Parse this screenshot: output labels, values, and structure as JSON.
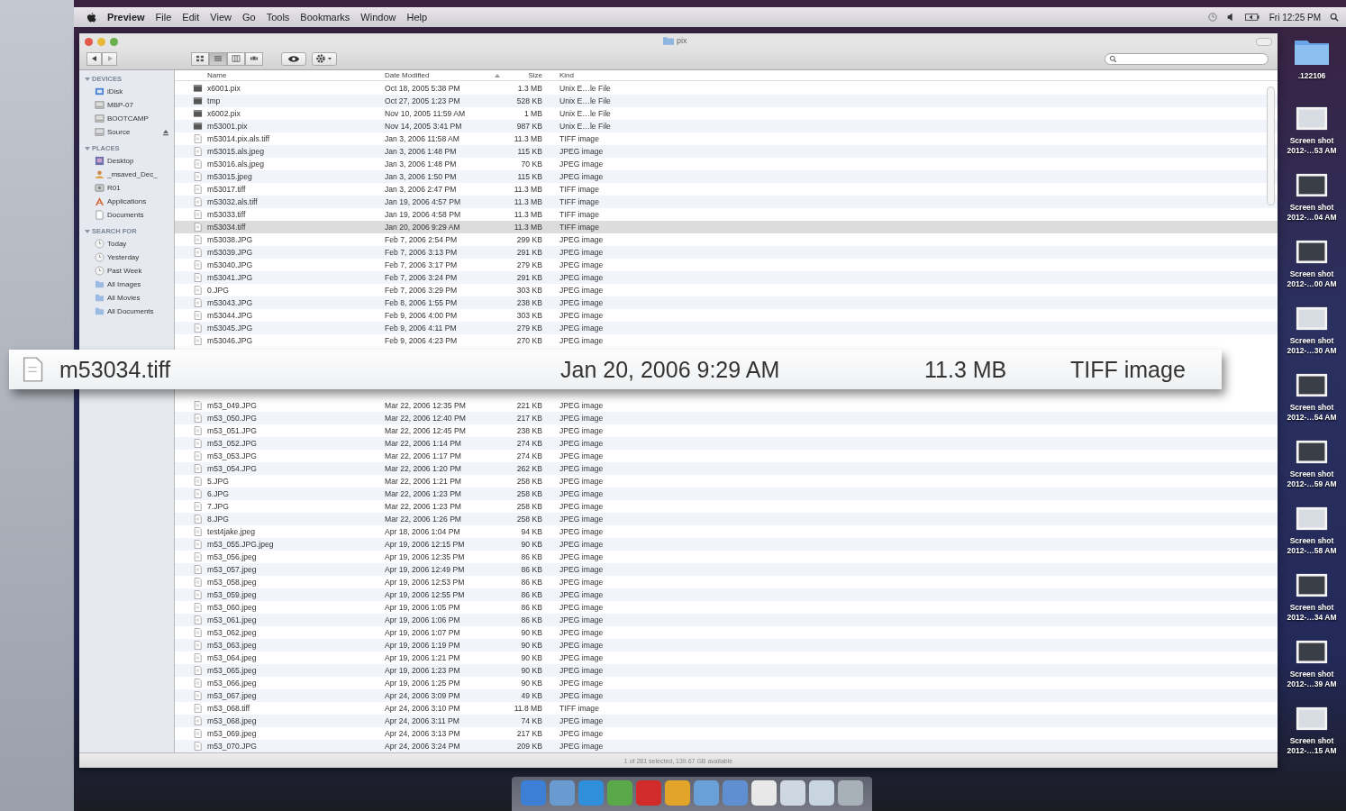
{
  "menubar": {
    "app": "Preview",
    "items": [
      "File",
      "Edit",
      "View",
      "Go",
      "Tools",
      "Bookmarks",
      "Window",
      "Help"
    ],
    "clock": "Fri 12:25 PM"
  },
  "window": {
    "title": "pix"
  },
  "toolbar": {
    "views": [
      {
        "kind": "icon",
        "selected": false
      },
      {
        "kind": "list",
        "selected": true
      },
      {
        "kind": "column",
        "selected": false
      },
      {
        "kind": "coverflow",
        "selected": false
      }
    ]
  },
  "sidebar": {
    "sections": [
      {
        "title": "DEVICES",
        "items": [
          {
            "label": "iDisk",
            "kind": "idisk",
            "eject": false
          },
          {
            "label": "MBP-07",
            "kind": "drive",
            "eject": false
          },
          {
            "label": "BOOTCAMP",
            "kind": "drive",
            "eject": false
          },
          {
            "label": "Source",
            "kind": "drive",
            "eject": true
          }
        ]
      },
      {
        "title": "PLACES",
        "items": [
          {
            "label": "Desktop",
            "kind": "desktop",
            "eject": false
          },
          {
            "label": "_msaved_Dec_",
            "kind": "user",
            "eject": false
          },
          {
            "label": "R01",
            "kind": "network",
            "eject": false
          },
          {
            "label": "Applications",
            "kind": "apps",
            "eject": false
          },
          {
            "label": "Documents",
            "kind": "docs",
            "eject": false
          }
        ]
      },
      {
        "title": "SEARCH FOR",
        "items": [
          {
            "label": "Today",
            "kind": "clock",
            "eject": false
          },
          {
            "label": "Yesterday",
            "kind": "clock",
            "eject": false
          },
          {
            "label": "Past Week",
            "kind": "clock",
            "eject": false
          },
          {
            "label": "All Images",
            "kind": "folder",
            "eject": false
          },
          {
            "label": "All Movies",
            "kind": "folder",
            "eject": false
          },
          {
            "label": "All Documents",
            "kind": "folder",
            "eject": false
          }
        ]
      }
    ]
  },
  "table": {
    "columns": [
      "Name",
      "Date Modified",
      "Size",
      "Kind"
    ],
    "rows": [
      {
        "kind": "exec",
        "name": "x6001.pix",
        "date": "Oct 18, 2005 5:38 PM",
        "size": "1.3 MB",
        "type": "Unix E…le File",
        "selected": false
      },
      {
        "kind": "exec",
        "name": "tmp",
        "date": "Oct 27, 2005 1:23 PM",
        "size": "528 KB",
        "type": "Unix E…le File",
        "selected": false
      },
      {
        "kind": "exec",
        "name": "x6002.pix",
        "date": "Nov 10, 2005 11:59 AM",
        "size": "1 MB",
        "type": "Unix E…le File",
        "selected": false
      },
      {
        "kind": "exec",
        "name": "m53001.pix",
        "date": "Nov 14, 2005 3:41 PM",
        "size": "987 KB",
        "type": "Unix E…le File",
        "selected": false
      },
      {
        "kind": "doc",
        "name": "m53014.pix.als.tiff",
        "date": "Jan 3, 2006 11:58 AM",
        "size": "11.3 MB",
        "type": "TIFF image",
        "selected": false
      },
      {
        "kind": "doc",
        "name": "m53015.als.jpeg",
        "date": "Jan 3, 2006 1:48 PM",
        "size": "115 KB",
        "type": "JPEG image",
        "selected": false
      },
      {
        "kind": "doc",
        "name": "m53016.als.jpeg",
        "date": "Jan 3, 2006 1:48 PM",
        "size": "70 KB",
        "type": "JPEG image",
        "selected": false
      },
      {
        "kind": "doc",
        "name": "m53015.jpeg",
        "date": "Jan 3, 2006 1:50 PM",
        "size": "115 KB",
        "type": "JPEG image",
        "selected": false
      },
      {
        "kind": "doc",
        "name": "m53017.tiff",
        "date": "Jan 3, 2006 2:47 PM",
        "size": "11.3 MB",
        "type": "TIFF image",
        "selected": false
      },
      {
        "kind": "doc",
        "name": "m53032.als.tiff",
        "date": "Jan 19, 2006 4:57 PM",
        "size": "11.3 MB",
        "type": "TIFF image",
        "selected": false
      },
      {
        "kind": "doc",
        "name": "m53033.tiff",
        "date": "Jan 19, 2006 4:58 PM",
        "size": "11.3 MB",
        "type": "TIFF image",
        "selected": false
      },
      {
        "kind": "doc",
        "name": "m53034.tiff",
        "date": "Jan 20, 2006 9:29 AM",
        "size": "11.3 MB",
        "type": "TIFF image",
        "selected": true
      },
      {
        "kind": "doc",
        "name": "m53038.JPG",
        "date": "Feb 7, 2006 2:54 PM",
        "size": "299 KB",
        "type": "JPEG image",
        "selected": false
      },
      {
        "kind": "doc",
        "name": "m53039.JPG",
        "date": "Feb 7, 2006 3:13 PM",
        "size": "291 KB",
        "type": "JPEG image",
        "selected": false
      },
      {
        "kind": "doc",
        "name": "m53040.JPG",
        "date": "Feb 7, 2006 3:17 PM",
        "size": "279 KB",
        "type": "JPEG image",
        "selected": false
      },
      {
        "kind": "doc",
        "name": "m53041.JPG",
        "date": "Feb 7, 2006 3:24 PM",
        "size": "291 KB",
        "type": "JPEG image",
        "selected": false
      },
      {
        "kind": "doc",
        "name": "0.JPG",
        "date": "Feb 7, 2006 3:29 PM",
        "size": "303 KB",
        "type": "JPEG image",
        "selected": false
      },
      {
        "kind": "doc",
        "name": "m53043.JPG",
        "date": "Feb 8, 2006 1:55 PM",
        "size": "238 KB",
        "type": "JPEG image",
        "selected": false
      },
      {
        "kind": "doc",
        "name": "m53044.JPG",
        "date": "Feb 9, 2006 4:00 PM",
        "size": "303 KB",
        "type": "JPEG image",
        "selected": false
      },
      {
        "kind": "doc",
        "name": "m53045.JPG",
        "date": "Feb 9, 2006 4:11 PM",
        "size": "279 KB",
        "type": "JPEG image",
        "selected": false
      },
      {
        "kind": "doc",
        "name": "m53046.JPG",
        "date": "Feb 9, 2006 4:23 PM",
        "size": "270 KB",
        "type": "JPEG image",
        "selected": false
      }
    ],
    "rows_after_callout": [
      {
        "kind": "doc",
        "name": "m53_049.JPG",
        "date": "Mar 22, 2006 12:35 PM",
        "size": "221 KB",
        "type": "JPEG image",
        "selected": false
      },
      {
        "kind": "doc",
        "name": "m53_050.JPG",
        "date": "Mar 22, 2006 12:40 PM",
        "size": "217 KB",
        "type": "JPEG image",
        "selected": false
      },
      {
        "kind": "doc",
        "name": "m53_051.JPG",
        "date": "Mar 22, 2006 12:45 PM",
        "size": "238 KB",
        "type": "JPEG image",
        "selected": false
      },
      {
        "kind": "doc",
        "name": "m53_052.JPG",
        "date": "Mar 22, 2006 1:14 PM",
        "size": "274 KB",
        "type": "JPEG image",
        "selected": false
      },
      {
        "kind": "doc",
        "name": "m53_053.JPG",
        "date": "Mar 22, 2006 1:17 PM",
        "size": "274 KB",
        "type": "JPEG image",
        "selected": false
      },
      {
        "kind": "doc",
        "name": "m53_054.JPG",
        "date": "Mar 22, 2006 1:20 PM",
        "size": "262 KB",
        "type": "JPEG image",
        "selected": false
      },
      {
        "kind": "doc",
        "name": "5.JPG",
        "date": "Mar 22, 2006 1:21 PM",
        "size": "258 KB",
        "type": "JPEG image",
        "selected": false
      },
      {
        "kind": "doc",
        "name": "6.JPG",
        "date": "Mar 22, 2006 1:23 PM",
        "size": "258 KB",
        "type": "JPEG image",
        "selected": false
      },
      {
        "kind": "doc",
        "name": "7.JPG",
        "date": "Mar 22, 2006 1:23 PM",
        "size": "258 KB",
        "type": "JPEG image",
        "selected": false
      },
      {
        "kind": "doc",
        "name": "8.JPG",
        "date": "Mar 22, 2006 1:26 PM",
        "size": "258 KB",
        "type": "JPEG image",
        "selected": false
      },
      {
        "kind": "doc",
        "name": "test4jake.jpeg",
        "date": "Apr 18, 2006 1:04 PM",
        "size": "94 KB",
        "type": "JPEG image",
        "selected": false
      },
      {
        "kind": "doc",
        "name": "m53_055.JPG.jpeg",
        "date": "Apr 19, 2006 12:15 PM",
        "size": "90 KB",
        "type": "JPEG image",
        "selected": false
      },
      {
        "kind": "doc",
        "name": "m53_056.jpeg",
        "date": "Apr 19, 2006 12:35 PM",
        "size": "86 KB",
        "type": "JPEG image",
        "selected": false
      },
      {
        "kind": "doc",
        "name": "m53_057.jpeg",
        "date": "Apr 19, 2006 12:49 PM",
        "size": "86 KB",
        "type": "JPEG image",
        "selected": false
      },
      {
        "kind": "doc",
        "name": "m53_058.jpeg",
        "date": "Apr 19, 2006 12:53 PM",
        "size": "86 KB",
        "type": "JPEG image",
        "selected": false
      },
      {
        "kind": "doc",
        "name": "m53_059.jpeg",
        "date": "Apr 19, 2006 12:55 PM",
        "size": "86 KB",
        "type": "JPEG image",
        "selected": false
      },
      {
        "kind": "doc",
        "name": "m53_060.jpeg",
        "date": "Apr 19, 2006 1:05 PM",
        "size": "86 KB",
        "type": "JPEG image",
        "selected": false
      },
      {
        "kind": "doc",
        "name": "m53_061.jpeg",
        "date": "Apr 19, 2006 1:06 PM",
        "size": "86 KB",
        "type": "JPEG image",
        "selected": false
      },
      {
        "kind": "doc",
        "name": "m53_062.jpeg",
        "date": "Apr 19, 2006 1:07 PM",
        "size": "90 KB",
        "type": "JPEG image",
        "selected": false
      },
      {
        "kind": "doc",
        "name": "m53_063.jpeg",
        "date": "Apr 19, 2006 1:19 PM",
        "size": "90 KB",
        "type": "JPEG image",
        "selected": false
      },
      {
        "kind": "doc",
        "name": "m53_064.jpeg",
        "date": "Apr 19, 2006 1:21 PM",
        "size": "90 KB",
        "type": "JPEG image",
        "selected": false
      },
      {
        "kind": "doc",
        "name": "m53_065.jpeg",
        "date": "Apr 19, 2006 1:23 PM",
        "size": "90 KB",
        "type": "JPEG image",
        "selected": false
      },
      {
        "kind": "doc",
        "name": "m53_066.jpeg",
        "date": "Apr 19, 2006 1:25 PM",
        "size": "90 KB",
        "type": "JPEG image",
        "selected": false
      },
      {
        "kind": "doc",
        "name": "m53_067.jpeg",
        "date": "Apr 24, 2006 3:09 PM",
        "size": "49 KB",
        "type": "JPEG image",
        "selected": false
      },
      {
        "kind": "doc",
        "name": "m53_068.tiff",
        "date": "Apr 24, 2006 3:10 PM",
        "size": "11.8 MB",
        "type": "TIFF image",
        "selected": false
      },
      {
        "kind": "doc",
        "name": "m53_068.jpeg",
        "date": "Apr 24, 2006 3:11 PM",
        "size": "74 KB",
        "type": "JPEG image",
        "selected": false
      },
      {
        "kind": "doc",
        "name": "m53_069.jpeg",
        "date": "Apr 24, 2006 3:13 PM",
        "size": "217 KB",
        "type": "JPEG image",
        "selected": false
      },
      {
        "kind": "doc",
        "name": "m53_070.JPG",
        "date": "Apr 24, 2006 3:24 PM",
        "size": "209 KB",
        "type": "JPEG image",
        "selected": false
      }
    ]
  },
  "status_bar": "1 of 281 selected, 139.67 GB available",
  "callout": {
    "name": "m53034.tiff",
    "date": "Jan 20, 2006 9:29 AM",
    "size": "11.3 MB",
    "type": "TIFF image"
  },
  "desktop_icons": [
    {
      "kind": "folder",
      "lines": [
        ".122106"
      ]
    },
    {
      "kind": "screenshot",
      "lines": [
        "Screen shot",
        "2012-…53 AM"
      ]
    },
    {
      "kind": "screenshot",
      "lines": [
        "Screen shot",
        "2012-…04 AM"
      ]
    },
    {
      "kind": "screenshot",
      "lines": [
        "Screen shot",
        "2012-…00 AM"
      ]
    },
    {
      "kind": "screenshot",
      "lines": [
        "Screen shot",
        "2012-…30 AM"
      ]
    },
    {
      "kind": "screenshot",
      "lines": [
        "Screen shot",
        "2012-…54 AM"
      ]
    },
    {
      "kind": "screenshot",
      "lines": [
        "Screen shot",
        "2012-…59 AM"
      ]
    },
    {
      "kind": "screenshot",
      "lines": [
        "Screen shot",
        "2012-…58 AM"
      ]
    },
    {
      "kind": "screenshot",
      "lines": [
        "Screen shot",
        "2012-…34 AM"
      ]
    },
    {
      "kind": "screenshot",
      "lines": [
        "Screen shot",
        "2012-…39 AM"
      ]
    },
    {
      "kind": "screenshot",
      "lines": [
        "Screen shot",
        "2012-…15 AM"
      ]
    }
  ]
}
